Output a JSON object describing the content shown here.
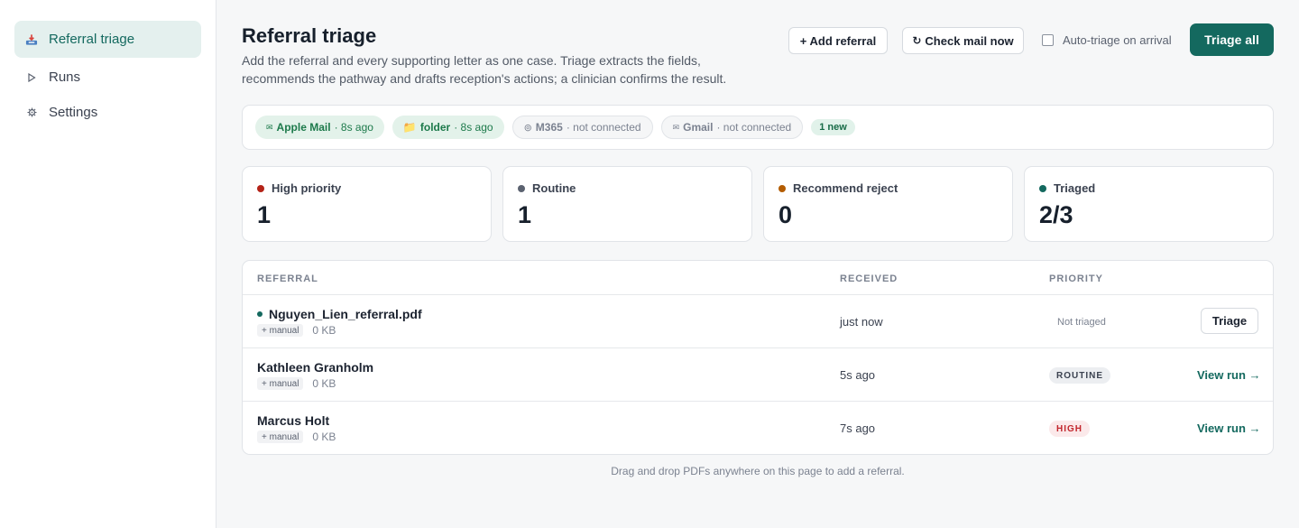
{
  "sidebar": {
    "items": [
      {
        "label": "Referral triage",
        "icon": "inbox-tray-icon"
      },
      {
        "label": "Runs",
        "icon": "play-icon"
      },
      {
        "label": "Settings",
        "icon": "gear-icon"
      }
    ]
  },
  "header": {
    "title": "Referral triage",
    "description": "Add the referral and every supporting letter as one case. Triage extracts the fields, recommends the pathway and drafts reception's actions; a clinician confirms the result.",
    "add_referral_label": "+ Add referral",
    "check_mail_icon": "↻",
    "check_mail_label": "Check mail now",
    "auto_triage_label": "Auto-triage on arrival",
    "triage_all_label": "Triage all"
  },
  "sources": {
    "chips": [
      {
        "icon": "✉",
        "name": "Apple Mail",
        "status": "· 8s ago"
      },
      {
        "icon": "📁",
        "name": "folder",
        "status": "· 8s ago"
      },
      {
        "icon": "⊚",
        "name": "M365",
        "status": "· not connected"
      },
      {
        "icon": "✉",
        "name": "Gmail",
        "status": "· not connected"
      }
    ],
    "new_badge": "1 new"
  },
  "stats": [
    {
      "label": "High priority",
      "value": "1",
      "color": "#b42318"
    },
    {
      "label": "Routine",
      "value": "1",
      "color": "#5b6270"
    },
    {
      "label": "Recommend reject",
      "value": "0",
      "color": "#b35c00"
    },
    {
      "label": "Triaged",
      "value": "2/3",
      "color": "#14695f"
    }
  ],
  "table": {
    "columns": [
      "REFERRAL",
      "RECEIVED",
      "PRIORITY"
    ],
    "rows": [
      {
        "name": "Nguyen_Lien_referral.pdf",
        "source": "+ manual",
        "size": "0 KB",
        "received": "just now",
        "status": "Not triaged",
        "action": "Triage"
      },
      {
        "name": "Kathleen Granholm",
        "source": "+ manual",
        "size": "0 KB",
        "received": "5s ago",
        "priority": "ROUTINE",
        "action": "View run →"
      },
      {
        "name": "Marcus Holt",
        "source": "+ manual",
        "size": "0 KB",
        "received": "7s ago",
        "priority": "HIGH",
        "action": "View run →"
      }
    ]
  },
  "footer": {
    "hint": "Drag and drop PDFs anywhere on this page to add a referral."
  },
  "colors": {
    "accent": "#14695f",
    "new_dot": "#14695f",
    "high": "#c2262d"
  }
}
